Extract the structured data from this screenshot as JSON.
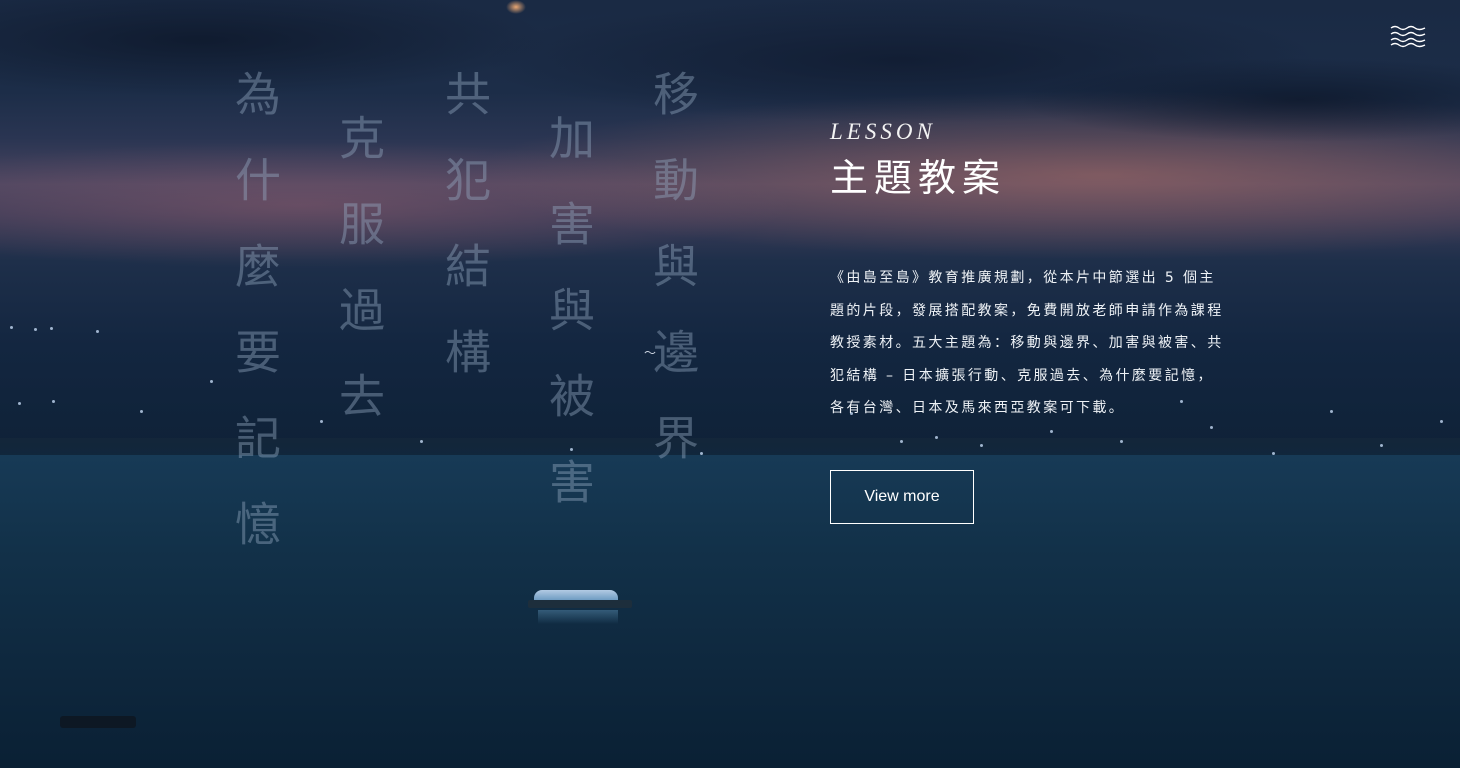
{
  "header": {
    "menu_icon": "hamburger-wave-icon"
  },
  "background": {
    "columns": [
      "為什麼要記憶",
      "克服過去",
      "共犯結構",
      "加害與被害",
      "移動與邊界"
    ]
  },
  "section": {
    "eyebrow": "LESSON",
    "title": "主題教案",
    "description": "《由島至島》教育推廣規劃，從本片中節選出 5 個主題的片段，發展搭配教案，免費開放老師申請作為課程教授素材。五大主題為：移動與邊界、加害與被害、共犯結構 – 日本擴張行動、克服過去、為什麼要記憶，各有台灣、日本及馬來西亞教案可下載。",
    "button_label": "View more"
  },
  "colors": {
    "text": "#ffffff",
    "column_text": "#96acc4",
    "sky_glow": "#b06e64",
    "sea": "#123149"
  }
}
